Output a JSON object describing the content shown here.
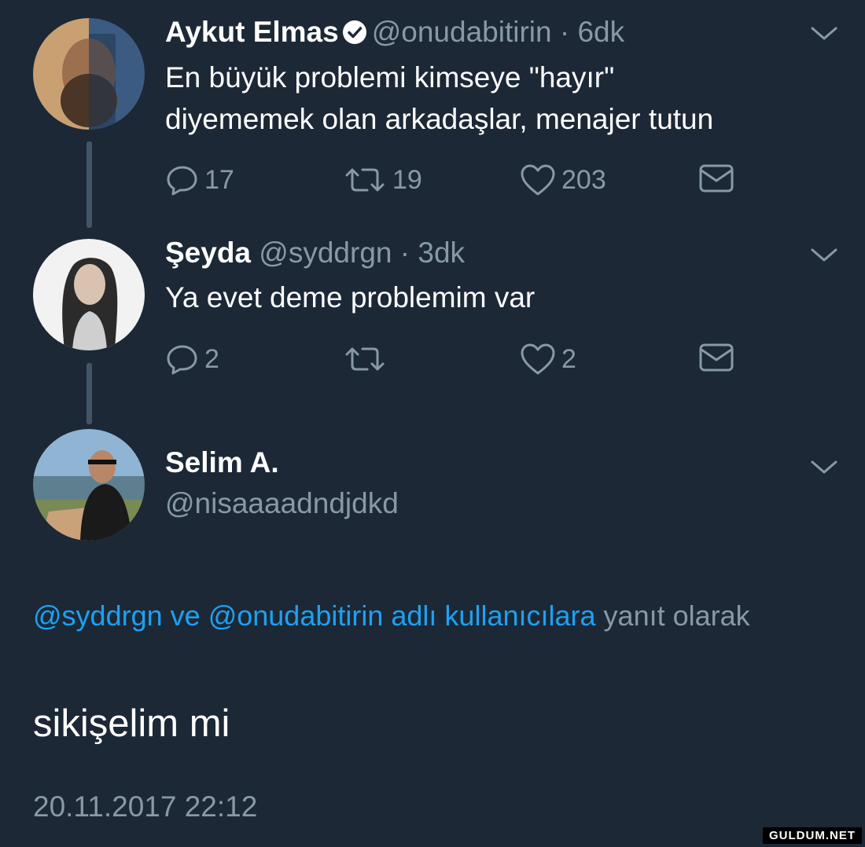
{
  "tweets": [
    {
      "name": "Aykut Elmas",
      "verified": true,
      "handle": "@onudabitirin",
      "separator": "·",
      "time": "6dk",
      "text_lines": [
        "En büyük problemi kimseye \"hayır\"",
        "diyememek olan arkadaşlar, menajer tutun"
      ],
      "reply_count": "17",
      "retweet_count": "19",
      "like_count": "203"
    },
    {
      "name": "Şeyda",
      "handle": "@syddrgn",
      "separator": "·",
      "time": "3dk",
      "text_lines": [
        "Ya evet deme problemim var"
      ],
      "reply_count": "2",
      "retweet_count": "",
      "like_count": "2"
    }
  ],
  "main_tweet": {
    "name": "Selim A.",
    "handle": "@nisaaaadndjdkd",
    "reply_to": {
      "mention1": "@syddrgn",
      "connector": "ve",
      "mention2": "@onudabitirin",
      "suffix_link": "adlı kullanıcılara",
      "suffix_text": "yanıt olarak"
    },
    "text": "sikişelim mi",
    "timestamp": "20.11.2017 22:12"
  },
  "watermark": "GULDUM.NET",
  "icons": {
    "reply": "reply-icon",
    "retweet": "retweet-icon",
    "like": "heart-icon",
    "dm": "envelope-icon",
    "more": "chevron-down-icon",
    "verified": "verified-badge-icon"
  },
  "colors": {
    "background": "#1c2836",
    "secondary_text": "#8899a6",
    "link": "#1da1f2"
  }
}
